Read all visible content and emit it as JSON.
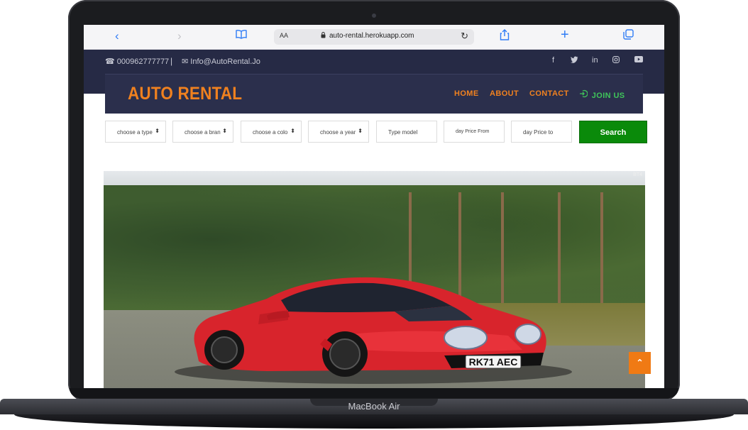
{
  "device": {
    "model": "MacBook Air"
  },
  "browser": {
    "address_aa": "AA",
    "url": "auto-rental.herokuapp.com"
  },
  "topbar": {
    "phone": "000962777777",
    "separator": "|",
    "email": "Info@AutoRental.Jo",
    "social": [
      "facebook-icon",
      "twitter-icon",
      "linkedin-icon",
      "instagram-icon",
      "youtube-icon"
    ]
  },
  "header": {
    "logo": "AUTO RENTAL",
    "nav": {
      "home": "HOME",
      "about": "ABOUT",
      "contact": "CONTACT",
      "join": "JOIN US"
    }
  },
  "search": {
    "type": "choose a type",
    "brand": "choose a bran",
    "color": "choose a colo",
    "year": "choose a year",
    "model_placeholder": "Type model",
    "price_from_placeholder": "day Price From",
    "price_to_placeholder": "day Price to",
    "button": "Search"
  },
  "hero": {
    "plate": "RK71 AEC",
    "badge": "BT4"
  },
  "colors": {
    "navy": "#262a45",
    "orange": "#f0811f",
    "green": "#0a8a0a",
    "join_green": "#3fc55a",
    "car_red": "#d8242c"
  }
}
